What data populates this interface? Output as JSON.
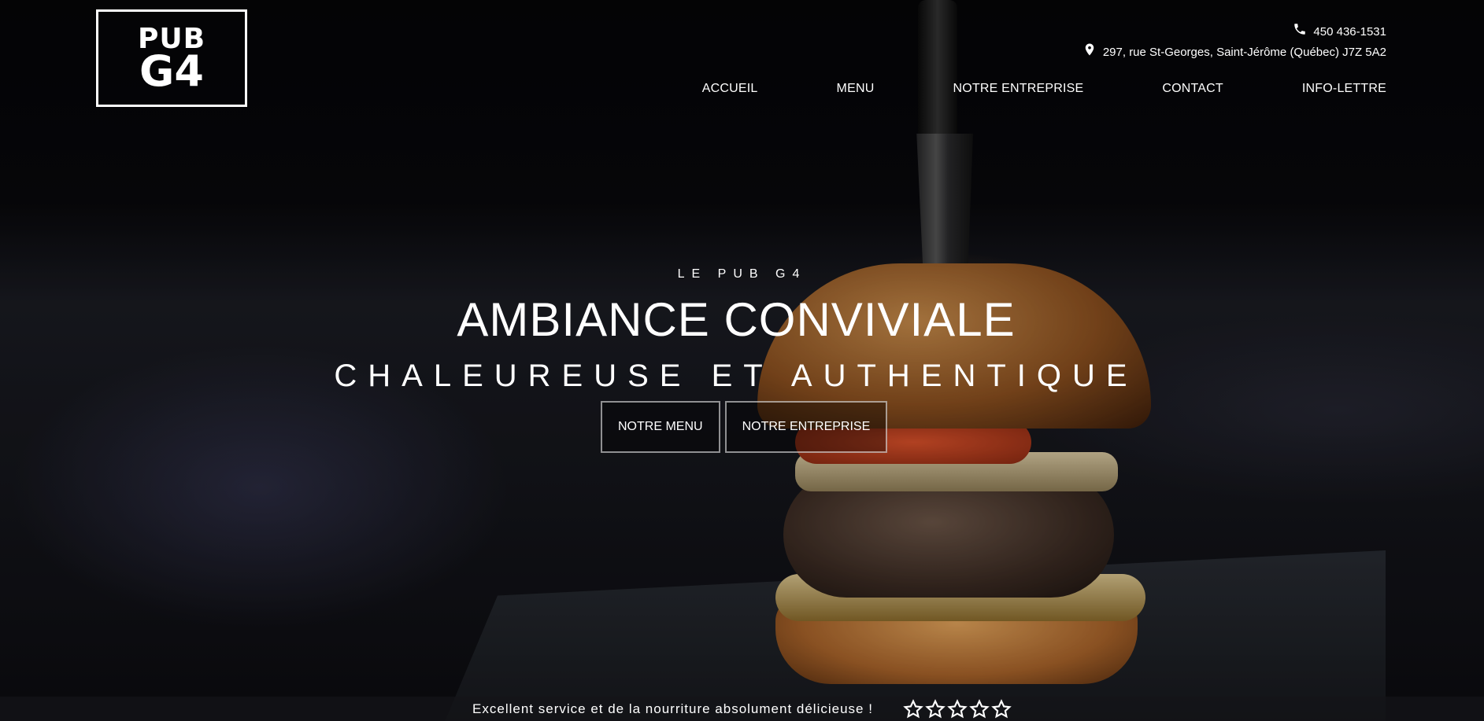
{
  "header": {
    "logo": {
      "line1": "PUB",
      "line2": "G4"
    },
    "phone": "450 436-1531",
    "address": "297, rue St-Georges, Saint-Jérôme (Québec) J7Z 5A2",
    "icons": {
      "phone": "phone-icon",
      "address": "map-pin-icon"
    }
  },
  "nav": {
    "items": [
      {
        "label": "ACCUEIL"
      },
      {
        "label": "MENU"
      },
      {
        "label": "NOTRE ENTREPRISE"
      },
      {
        "label": "CONTACT"
      },
      {
        "label": "INFO-LETTRE"
      }
    ]
  },
  "hero": {
    "kicker": "LE PUB G4",
    "headline": "AMBIANCE CONVIVIALE",
    "subline": "CHALEUREUSE ET AUTHENTIQUE",
    "buttons": [
      {
        "label": "NOTRE MENU"
      },
      {
        "label": "NOTRE ENTREPRISE"
      }
    ]
  },
  "testimonial": {
    "text": "Excellent service et de la nourriture absolument délicieuse !",
    "rating": {
      "filled": 0,
      "max": 5
    },
    "star_icon": "star-outline-icon"
  },
  "colors": {
    "text": "#ffffff",
    "background": "#000000"
  }
}
